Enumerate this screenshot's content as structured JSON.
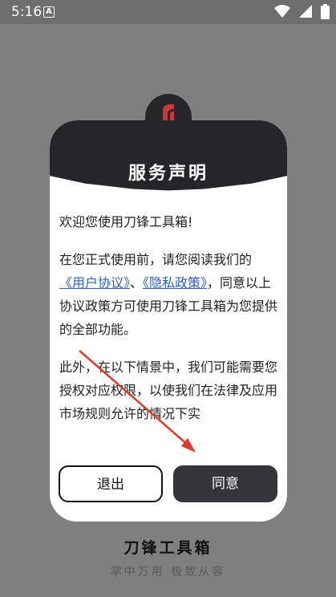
{
  "status_bar": {
    "time": "5:16",
    "notification_icon": "a-notification-icon",
    "icons": [
      "wifi-icon",
      "signal-icon",
      "battery-icon"
    ]
  },
  "dialog": {
    "title": "服务声明",
    "logo_icon": "app-logo-icon",
    "greeting": "欢迎您使用刀锋工具箱!",
    "p2_before": "在您正式使用前，请您阅读我们的",
    "link_user_agreement": "《用户协议》",
    "separator": "、",
    "link_privacy_policy": "《隐私政策》",
    "p2_after": "，同意以上协议政策方可使用刀锋工具箱为您提供的全部功能。",
    "p3": " 此外，在以下情景中，我们可能需要您授权对应权限，以使我们在法律及应用市场规则允许的情况下实",
    "exit_button": "退出",
    "agree_button": "同意"
  },
  "app": {
    "name": "刀锋工具箱",
    "slogan": "掌中万用 极致从容"
  },
  "colors": {
    "overlay_bg": "#7f7f7f",
    "dialog_dark": "#26262a",
    "link": "#2a61c9",
    "arrow": "#e33a2e",
    "logo_red": "#c8393a"
  }
}
